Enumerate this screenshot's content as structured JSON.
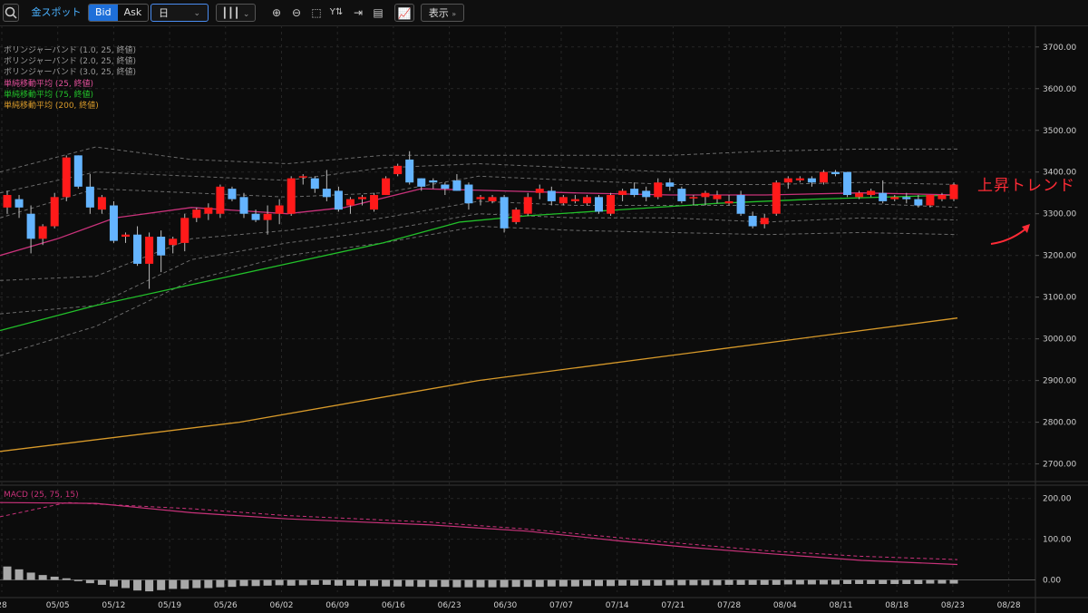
{
  "toolbar": {
    "symbol": "金スポット",
    "bid_label": "Bid",
    "ask_label": "Ask",
    "period_value": "日",
    "display_label": "表示"
  },
  "legend": [
    {
      "text": "ボリンジャーバンド (1.0, 25, 終値)",
      "color": "#9a9a9a"
    },
    {
      "text": "ボリンジャーバンド (2.0, 25, 終値)",
      "color": "#9a9a9a"
    },
    {
      "text": "ボリンジャーバンド (3.0, 25, 終値)",
      "color": "#9a9a9a"
    },
    {
      "text": "単純移動平均 (25, 終値)",
      "color": "#e0509a"
    },
    {
      "text": "単純移動平均 (75, 終値)",
      "color": "#22c02a"
    },
    {
      "text": "単純移動平均 (200, 終値)",
      "color": "#d89a2a"
    }
  ],
  "macd_label": "MACD (25, 75, 15)",
  "annotation": "上昇トレンド",
  "colors": {
    "up": "#ff1a1a",
    "down": "#64b4ff",
    "sma25": "#c8327a",
    "sma75": "#22c02a",
    "sma200": "#d89a2a",
    "bands": "#8a8a8a",
    "annotation": "#ff2b36"
  },
  "chart_data": {
    "type": "candlestick",
    "price_axis": {
      "ticks": [
        "3700.00",
        "3600.00",
        "3500.00",
        "3400.00",
        "3300.00",
        "3200.00",
        "3100.00",
        "3000.00",
        "2900.00",
        "2800.00",
        "2700.00"
      ],
      "range": [
        2660,
        3730
      ]
    },
    "macd_axis": {
      "ticks": [
        "200.00",
        "100.00",
        "0.00"
      ],
      "range": [
        -30,
        215
      ]
    },
    "date_ticks": [
      "28",
      "05/05",
      "05/12",
      "05/19",
      "05/26",
      "06/02",
      "06/09",
      "06/16",
      "06/23",
      "06/30",
      "07/07",
      "07/14",
      "07/21",
      "07/28",
      "08/04",
      "08/11",
      "08/18",
      "08/23",
      "08/28"
    ],
    "candles": [
      {
        "o": 3315,
        "h": 3355,
        "l": 3300,
        "c": 3345
      },
      {
        "o": 3335,
        "h": 3345,
        "l": 3290,
        "c": 3315
      },
      {
        "o": 3300,
        "h": 3320,
        "l": 3205,
        "c": 3240
      },
      {
        "o": 3240,
        "h": 3275,
        "l": 3225,
        "c": 3270
      },
      {
        "o": 3270,
        "h": 3350,
        "l": 3265,
        "c": 3340
      },
      {
        "o": 3340,
        "h": 3440,
        "l": 3330,
        "c": 3435
      },
      {
        "o": 3440,
        "h": 3440,
        "l": 3360,
        "c": 3365
      },
      {
        "o": 3365,
        "h": 3395,
        "l": 3300,
        "c": 3315
      },
      {
        "o": 3310,
        "h": 3345,
        "l": 3300,
        "c": 3340
      },
      {
        "o": 3320,
        "h": 3330,
        "l": 3230,
        "c": 3235
      },
      {
        "o": 3245,
        "h": 3255,
        "l": 3230,
        "c": 3250
      },
      {
        "o": 3250,
        "h": 3270,
        "l": 3175,
        "c": 3180
      },
      {
        "o": 3180,
        "h": 3255,
        "l": 3120,
        "c": 3245
      },
      {
        "o": 3245,
        "h": 3260,
        "l": 3160,
        "c": 3200
      },
      {
        "o": 3225,
        "h": 3245,
        "l": 3205,
        "c": 3240
      },
      {
        "o": 3230,
        "h": 3300,
        "l": 3210,
        "c": 3290
      },
      {
        "o": 3290,
        "h": 3315,
        "l": 3280,
        "c": 3310
      },
      {
        "o": 3300,
        "h": 3325,
        "l": 3285,
        "c": 3315
      },
      {
        "o": 3300,
        "h": 3370,
        "l": 3290,
        "c": 3365
      },
      {
        "o": 3360,
        "h": 3365,
        "l": 3330,
        "c": 3335
      },
      {
        "o": 3340,
        "h": 3350,
        "l": 3290,
        "c": 3300
      },
      {
        "o": 3300,
        "h": 3310,
        "l": 3280,
        "c": 3285
      },
      {
        "o": 3285,
        "h": 3320,
        "l": 3250,
        "c": 3300
      },
      {
        "o": 3300,
        "h": 3335,
        "l": 3275,
        "c": 3320
      },
      {
        "o": 3300,
        "h": 3390,
        "l": 3295,
        "c": 3385
      },
      {
        "o": 3390,
        "h": 3395,
        "l": 3370,
        "c": 3390
      },
      {
        "o": 3385,
        "h": 3390,
        "l": 3350,
        "c": 3360
      },
      {
        "o": 3360,
        "h": 3405,
        "l": 3330,
        "c": 3340
      },
      {
        "o": 3355,
        "h": 3365,
        "l": 3305,
        "c": 3310
      },
      {
        "o": 3320,
        "h": 3340,
        "l": 3300,
        "c": 3335
      },
      {
        "o": 3335,
        "h": 3345,
        "l": 3320,
        "c": 3340
      },
      {
        "o": 3310,
        "h": 3350,
        "l": 3305,
        "c": 3345
      },
      {
        "o": 3345,
        "h": 3390,
        "l": 3345,
        "c": 3385
      },
      {
        "o": 3395,
        "h": 3420,
        "l": 3390,
        "c": 3415
      },
      {
        "o": 3430,
        "h": 3450,
        "l": 3370,
        "c": 3375
      },
      {
        "o": 3385,
        "h": 3385,
        "l": 3355,
        "c": 3365
      },
      {
        "o": 3380,
        "h": 3385,
        "l": 3360,
        "c": 3375
      },
      {
        "o": 3370,
        "h": 3375,
        "l": 3345,
        "c": 3360
      },
      {
        "o": 3380,
        "h": 3395,
        "l": 3355,
        "c": 3355
      },
      {
        "o": 3370,
        "h": 3375,
        "l": 3310,
        "c": 3325
      },
      {
        "o": 3335,
        "h": 3345,
        "l": 3320,
        "c": 3340
      },
      {
        "o": 3330,
        "h": 3345,
        "l": 3325,
        "c": 3340
      },
      {
        "o": 3340,
        "h": 3345,
        "l": 3255,
        "c": 3265
      },
      {
        "o": 3280,
        "h": 3315,
        "l": 3275,
        "c": 3310
      },
      {
        "o": 3300,
        "h": 3350,
        "l": 3295,
        "c": 3340
      },
      {
        "o": 3350,
        "h": 3370,
        "l": 3335,
        "c": 3360
      },
      {
        "o": 3355,
        "h": 3365,
        "l": 3320,
        "c": 3330
      },
      {
        "o": 3325,
        "h": 3345,
        "l": 3320,
        "c": 3340
      },
      {
        "o": 3330,
        "h": 3345,
        "l": 3325,
        "c": 3335
      },
      {
        "o": 3325,
        "h": 3345,
        "l": 3320,
        "c": 3340
      },
      {
        "o": 3340,
        "h": 3345,
        "l": 3300,
        "c": 3305
      },
      {
        "o": 3300,
        "h": 3350,
        "l": 3295,
        "c": 3345
      },
      {
        "o": 3345,
        "h": 3360,
        "l": 3330,
        "c": 3355
      },
      {
        "o": 3360,
        "h": 3375,
        "l": 3340,
        "c": 3345
      },
      {
        "o": 3355,
        "h": 3365,
        "l": 3330,
        "c": 3340
      },
      {
        "o": 3340,
        "h": 3385,
        "l": 3335,
        "c": 3375
      },
      {
        "o": 3375,
        "h": 3385,
        "l": 3355,
        "c": 3365
      },
      {
        "o": 3360,
        "h": 3365,
        "l": 3325,
        "c": 3330
      },
      {
        "o": 3340,
        "h": 3345,
        "l": 3320,
        "c": 3340
      },
      {
        "o": 3340,
        "h": 3355,
        "l": 3320,
        "c": 3350
      },
      {
        "o": 3335,
        "h": 3355,
        "l": 3325,
        "c": 3345
      },
      {
        "o": 3325,
        "h": 3345,
        "l": 3320,
        "c": 3330
      },
      {
        "o": 3345,
        "h": 3355,
        "l": 3295,
        "c": 3300
      },
      {
        "o": 3295,
        "h": 3305,
        "l": 3265,
        "c": 3270
      },
      {
        "o": 3275,
        "h": 3300,
        "l": 3265,
        "c": 3290
      },
      {
        "o": 3300,
        "h": 3380,
        "l": 3295,
        "c": 3375
      },
      {
        "o": 3375,
        "h": 3390,
        "l": 3360,
        "c": 3385
      },
      {
        "o": 3380,
        "h": 3390,
        "l": 3375,
        "c": 3385
      },
      {
        "o": 3385,
        "h": 3390,
        "l": 3365,
        "c": 3375
      },
      {
        "o": 3375,
        "h": 3405,
        "l": 3370,
        "c": 3400
      },
      {
        "o": 3400,
        "h": 3405,
        "l": 3390,
        "c": 3395
      },
      {
        "o": 3400,
        "h": 3400,
        "l": 3340,
        "c": 3345
      },
      {
        "o": 3340,
        "h": 3355,
        "l": 3335,
        "c": 3350
      },
      {
        "o": 3345,
        "h": 3360,
        "l": 3340,
        "c": 3355
      },
      {
        "o": 3350,
        "h": 3380,
        "l": 3325,
        "c": 3330
      },
      {
        "o": 3335,
        "h": 3345,
        "l": 3330,
        "c": 3340
      },
      {
        "o": 3340,
        "h": 3350,
        "l": 3325,
        "c": 3335
      },
      {
        "o": 3335,
        "h": 3345,
        "l": 3315,
        "c": 3320
      },
      {
        "o": 3320,
        "h": 3345,
        "l": 3315,
        "c": 3345
      },
      {
        "o": 3335,
        "h": 3350,
        "l": 3330,
        "c": 3345
      },
      {
        "o": 3335,
        "h": 3375,
        "l": 3330,
        "c": 3370
      }
    ],
    "sma25": [
      [
        0,
        3200
      ],
      [
        0.06,
        3240
      ],
      [
        0.12,
        3290
      ],
      [
        0.2,
        3315
      ],
      [
        0.3,
        3300
      ],
      [
        0.36,
        3315
      ],
      [
        0.44,
        3360
      ],
      [
        0.52,
        3355
      ],
      [
        0.6,
        3350
      ],
      [
        0.7,
        3345
      ],
      [
        0.8,
        3345
      ],
      [
        0.9,
        3350
      ],
      [
        1,
        3345
      ]
    ],
    "sma75": [
      [
        0,
        3020
      ],
      [
        0.1,
        3080
      ],
      [
        0.2,
        3130
      ],
      [
        0.3,
        3180
      ],
      [
        0.4,
        3230
      ],
      [
        0.48,
        3280
      ],
      [
        0.55,
        3295
      ],
      [
        0.65,
        3310
      ],
      [
        0.75,
        3325
      ],
      [
        0.85,
        3335
      ],
      [
        1,
        3345
      ]
    ],
    "sma200": [
      [
        0,
        2730
      ],
      [
        0.25,
        2800
      ],
      [
        0.5,
        2900
      ],
      [
        0.75,
        2975
      ],
      [
        1,
        3050
      ]
    ],
    "band1_up": [
      [
        0,
        3290
      ],
      [
        0.1,
        3360
      ],
      [
        0.2,
        3350
      ],
      [
        0.3,
        3340
      ],
      [
        0.4,
        3350
      ],
      [
        0.5,
        3390
      ],
      [
        0.6,
        3380
      ],
      [
        0.7,
        3370
      ],
      [
        0.8,
        3370
      ],
      [
        0.9,
        3375
      ],
      [
        1,
        3370
      ]
    ],
    "band1_dn": [
      [
        0,
        3140
      ],
      [
        0.1,
        3150
      ],
      [
        0.2,
        3240
      ],
      [
        0.3,
        3260
      ],
      [
        0.4,
        3290
      ],
      [
        0.5,
        3330
      ],
      [
        0.6,
        3320
      ],
      [
        0.7,
        3320
      ],
      [
        0.8,
        3320
      ],
      [
        0.9,
        3325
      ],
      [
        1,
        3315
      ]
    ],
    "band2_up": [
      [
        0,
        3350
      ],
      [
        0.1,
        3400
      ],
      [
        0.2,
        3390
      ],
      [
        0.3,
        3380
      ],
      [
        0.4,
        3410
      ],
      [
        0.5,
        3420
      ],
      [
        0.6,
        3410
      ],
      [
        0.7,
        3400
      ],
      [
        0.8,
        3400
      ],
      [
        0.9,
        3400
      ],
      [
        1,
        3400
      ]
    ],
    "band2_dn": [
      [
        0,
        3060
      ],
      [
        0.1,
        3080
      ],
      [
        0.2,
        3190
      ],
      [
        0.3,
        3230
      ],
      [
        0.4,
        3260
      ],
      [
        0.5,
        3300
      ],
      [
        0.6,
        3290
      ],
      [
        0.7,
        3290
      ],
      [
        0.8,
        3280
      ],
      [
        0.9,
        3290
      ],
      [
        1,
        3285
      ]
    ],
    "band3_up": [
      [
        0,
        3400
      ],
      [
        0.1,
        3460
      ],
      [
        0.2,
        3430
      ],
      [
        0.3,
        3420
      ],
      [
        0.4,
        3440
      ],
      [
        0.5,
        3440
      ],
      [
        0.6,
        3440
      ],
      [
        0.7,
        3440
      ],
      [
        0.8,
        3450
      ],
      [
        0.9,
        3455
      ],
      [
        1,
        3455
      ]
    ],
    "band3_dn": [
      [
        0,
        2960
      ],
      [
        0.1,
        3030
      ],
      [
        0.2,
        3140
      ],
      [
        0.3,
        3200
      ],
      [
        0.4,
        3230
      ],
      [
        0.5,
        3270
      ],
      [
        0.6,
        3260
      ],
      [
        0.7,
        3255
      ],
      [
        0.8,
        3250
      ],
      [
        0.9,
        3255
      ],
      [
        1,
        3250
      ]
    ],
    "macd": [
      [
        0,
        190
      ],
      [
        0.1,
        188
      ],
      [
        0.2,
        165
      ],
      [
        0.3,
        150
      ],
      [
        0.45,
        135
      ],
      [
        0.55,
        120
      ],
      [
        0.65,
        95
      ],
      [
        0.72,
        80
      ],
      [
        0.8,
        65
      ],
      [
        0.9,
        48
      ],
      [
        1,
        38
      ]
    ],
    "signal": [
      [
        0,
        155
      ],
      [
        0.07,
        190
      ],
      [
        0.2,
        175
      ],
      [
        0.3,
        158
      ],
      [
        0.45,
        142
      ],
      [
        0.55,
        125
      ],
      [
        0.65,
        103
      ],
      [
        0.72,
        88
      ],
      [
        0.8,
        72
      ],
      [
        0.9,
        58
      ],
      [
        1,
        50
      ]
    ],
    "histogram": [
      33,
      26,
      18,
      12,
      8,
      4,
      -3,
      -8,
      -12,
      -16,
      -20,
      -26,
      -28,
      -25,
      -22,
      -22,
      -20,
      -20,
      -18,
      -17,
      -15,
      -15,
      -14,
      -13,
      -14,
      -13,
      -12,
      -12,
      -14,
      -14,
      -15,
      -15,
      -16,
      -16,
      -16,
      -17,
      -17,
      -17,
      -18,
      -18,
      -18,
      -18,
      -18,
      -17,
      -17,
      -17,
      -16,
      -16,
      -16,
      -15,
      -15,
      -15,
      -14,
      -14,
      -14,
      -14,
      -13,
      -13,
      -13,
      -13,
      -13,
      -12,
      -12,
      -12,
      -12,
      -12,
      -11,
      -11,
      -11,
      -11,
      -11,
      -10,
      -10,
      -10,
      -10,
      -10,
      -10,
      -10,
      -9,
      -9,
      -9
    ]
  }
}
